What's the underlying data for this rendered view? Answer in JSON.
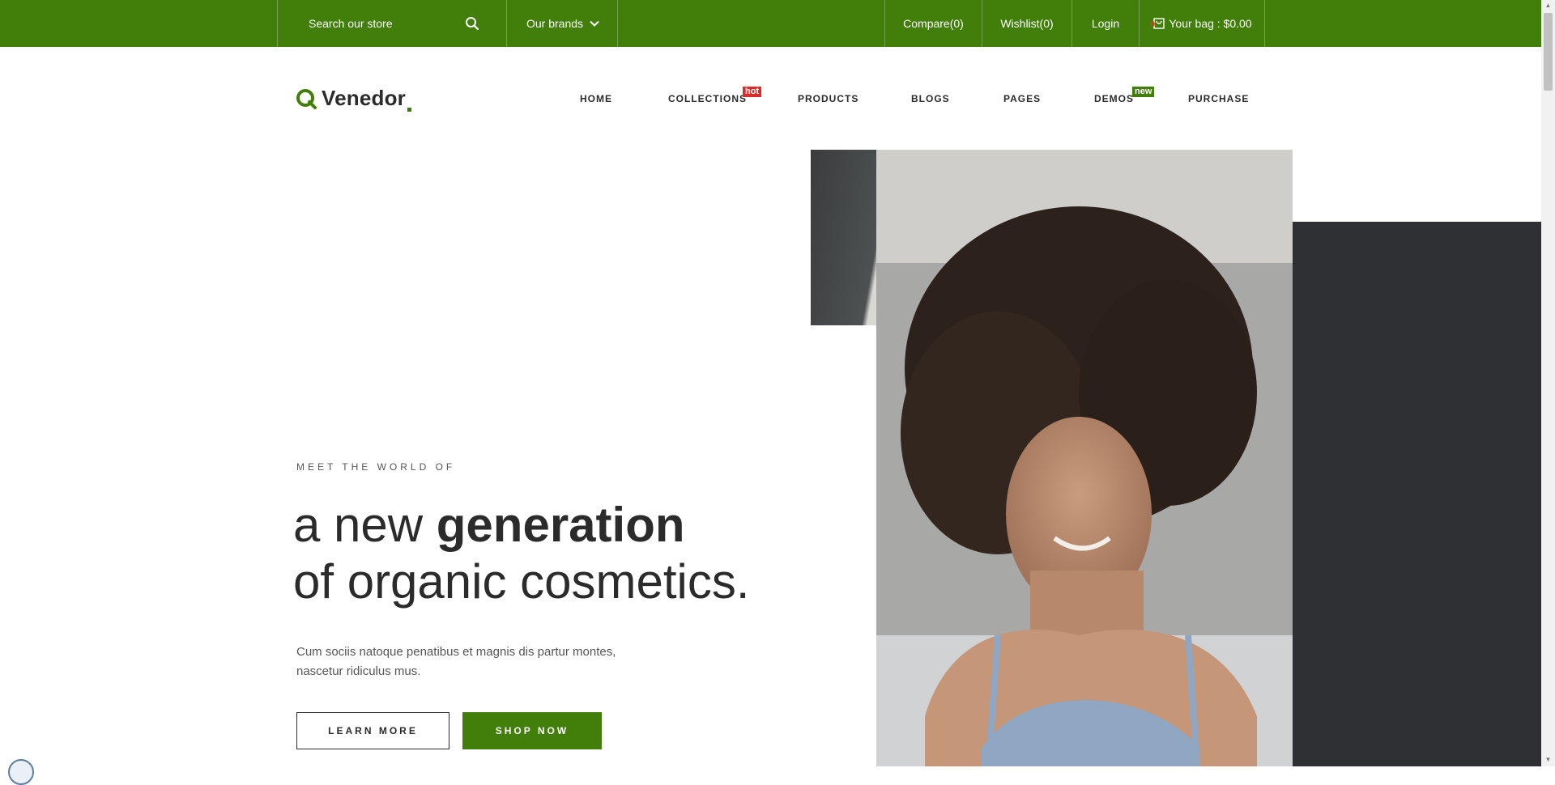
{
  "topbar": {
    "search_placeholder": "Search our store",
    "brands_label": "Our brands",
    "compare_label": "Compare(0)",
    "wishlist_label": "Wishlist(0)",
    "login_label": "Login",
    "cart_count": "0",
    "bag_label": "Your bag : $0.00"
  },
  "header": {
    "logo_text": "Venedor",
    "nav": [
      {
        "label": "HOME"
      },
      {
        "label": "COLLECTIONS",
        "badge": "hot"
      },
      {
        "label": "PRODUCTS"
      },
      {
        "label": "BLOGS"
      },
      {
        "label": "PAGES"
      },
      {
        "label": "DEMOS",
        "badge": "new"
      },
      {
        "label": "PURCHASE"
      }
    ]
  },
  "hero": {
    "eyebrow": "MEET THE WORLD OF",
    "headline_light": "a new ",
    "headline_bold": "generation",
    "headline_line2": "of organic cosmetics.",
    "description": "Cum sociis natoque penatibus et magnis dis partur montes, nascetur ridiculus mus.",
    "learn_more": "LEARN MORE",
    "shop_now": "SHOP NOW"
  },
  "colors": {
    "brand_green": "#417f0a",
    "hot_badge": "#d62d2d",
    "dark_panel": "#2f3033"
  },
  "icons": [
    "search-icon",
    "chevron-down-icon",
    "cart-icon",
    "logo-icon"
  ]
}
